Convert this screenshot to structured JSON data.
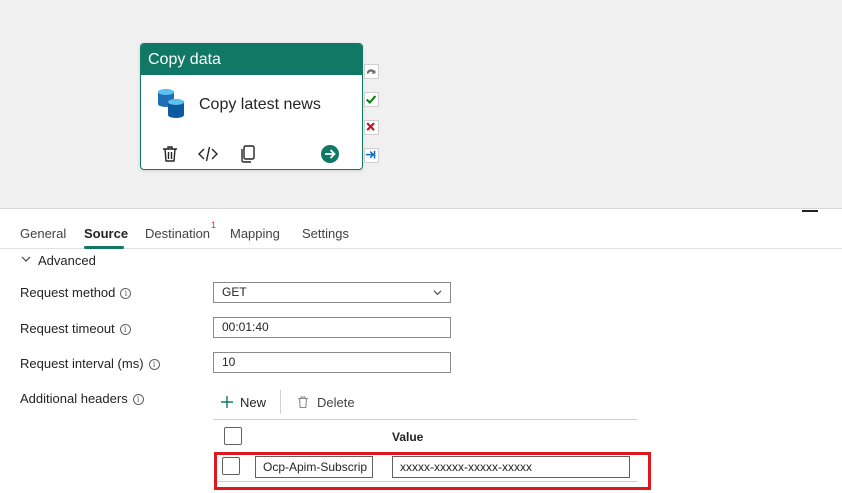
{
  "activity": {
    "type_label": "Copy data",
    "name": "Copy latest news",
    "tools": [
      "delete-icon",
      "code-icon",
      "copy-icon",
      "go-arrow-icon"
    ],
    "side_icons": [
      "skip-icon",
      "success-icon",
      "fail-icon",
      "completion-icon"
    ],
    "header_color": "#117865"
  },
  "tabs": [
    {
      "label": "General",
      "active": false
    },
    {
      "label": "Source",
      "active": true
    },
    {
      "label": "Destination",
      "active": false,
      "badge": "1"
    },
    {
      "label": "Mapping",
      "active": false
    },
    {
      "label": "Settings",
      "active": false
    }
  ],
  "advanced": {
    "label": "Advanced"
  },
  "form": {
    "request_method": {
      "label": "Request method",
      "value": "GET"
    },
    "request_timeout": {
      "label": "Request timeout",
      "value": "00:01:40"
    },
    "request_interval": {
      "label": "Request interval (ms)",
      "value": "10"
    },
    "additional_headers": {
      "label": "Additional headers"
    }
  },
  "headers_table": {
    "new_label": "New",
    "delete_label": "Delete",
    "value_column": "Value",
    "rows": [
      {
        "name": "Ocp-Apim-Subscrip",
        "value": "xxxxx-xxxxx-xxxxx-xxxxx"
      }
    ]
  },
  "colors": {
    "accent": "#117865",
    "highlight": "#e0181e",
    "badge": "#c4314b"
  }
}
